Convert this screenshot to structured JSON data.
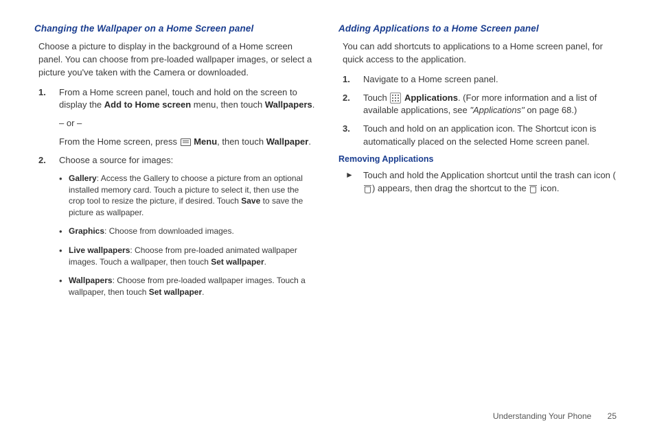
{
  "left": {
    "heading": "Changing the Wallpaper on a Home Screen panel",
    "intro": "Choose a picture to display in the background of a Home screen panel. You can choose from pre-loaded wallpaper images, or select a picture you've taken with the Camera or downloaded.",
    "step1_pre": "From a Home screen panel, touch and hold on the screen to display the ",
    "step1_b1": "Add to Home screen",
    "step1_mid": " menu, then touch ",
    "step1_b2": "Wallpapers",
    "step1_end": ".",
    "or": "– or –",
    "step1b_pre": "From the Home screen, press ",
    "step1b_b1": "Menu",
    "step1b_mid": ", then touch ",
    "step1b_b2": "Wallpaper",
    "step1b_end": ".",
    "step2": "Choose a source for images:",
    "bullets": [
      {
        "b": "Gallery",
        "t": ": Access the Gallery to choose a picture from an optional installed memory card. Touch a picture to select it, then use the crop tool to resize the picture, if desired. Touch ",
        "b2": "Save",
        "t2": " to save the picture as wallpaper."
      },
      {
        "b": "Graphics",
        "t": ": Choose from downloaded images."
      },
      {
        "b": "Live wallpapers",
        "t": ": Choose from pre-loaded animated wallpaper images. Touch a wallpaper, then touch ",
        "b2": "Set wallpaper",
        "t2": "."
      },
      {
        "b": "Wallpapers",
        "t": ": Choose from pre-loaded wallpaper images. Touch a wallpaper, then touch ",
        "b2": "Set wallpaper",
        "t2": "."
      }
    ]
  },
  "right": {
    "heading": "Adding Applications to a Home Screen panel",
    "intro": "You can add shortcuts to applications to a Home screen panel, for quick access to the application.",
    "step1": "Navigate to a Home screen panel.",
    "step2_pre": "Touch ",
    "step2_b1": "Applications",
    "step2_mid": ". (For more information and a list of available applications, see ",
    "step2_ital": "\"Applications\"",
    "step2_end": " on page 68.)",
    "step3": "Touch and hold on an application icon. The Shortcut icon is automatically placed on the selected Home screen panel.",
    "subheading": "Removing Applications",
    "arrow_pre": "Touch and hold the Application shortcut until the trash can icon (",
    "arrow_mid": ") appears, then drag the shortcut to the ",
    "arrow_end": " icon."
  },
  "footer": {
    "section": "Understanding Your Phone",
    "page": "25"
  }
}
